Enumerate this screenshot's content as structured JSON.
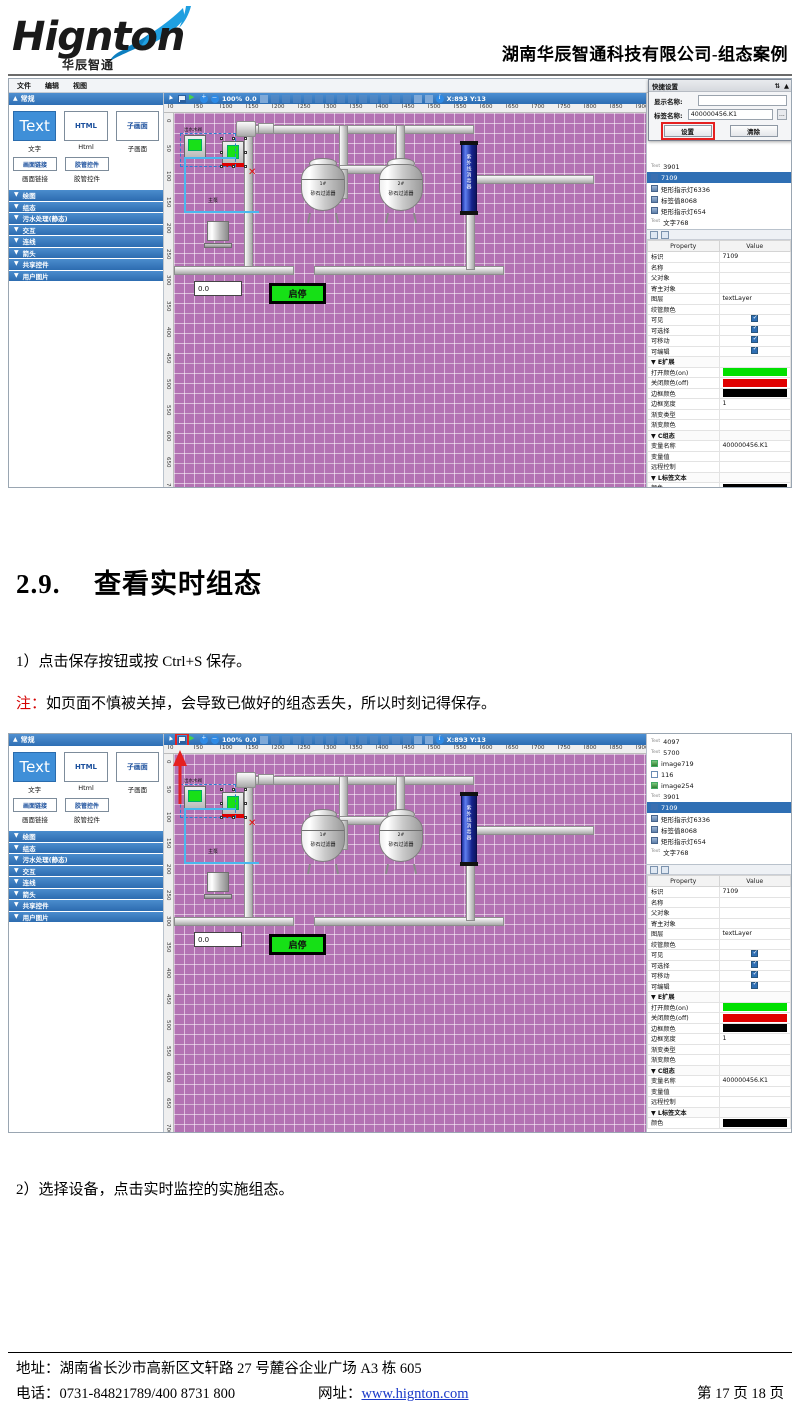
{
  "header": {
    "logo_text": "Hignton",
    "logo_sub": "华辰智通",
    "title": "湖南华辰智通科技有限公司-组态案例"
  },
  "document": {
    "section_number": "2.9.",
    "section_title": "查看实时组态",
    "step1": "1）点击保存按钮或按 Ctrl+S 保存。",
    "note_label": "注：",
    "note_text": "如页面不慎被关掉，会导致已做好的组态丢失，所以时刻记得保存。",
    "step2": "2）选择设备，点击实时监控的实施组态。"
  },
  "footer": {
    "address": "地址：湖南省长沙市高新区文轩路 27 号麓谷企业广场 A3 栋 605",
    "phone": "电话：0731-84821789/400 8731 800",
    "web_label": "网址：",
    "web_url": "www.hignton.com",
    "page": "第 17 页 18 页"
  },
  "app": {
    "menubar": [
      "文件",
      "编辑",
      "视图"
    ],
    "toolbox": {
      "header": "常规",
      "items": [
        {
          "swatch": "Text",
          "label": "文字"
        },
        {
          "swatch": "HTML",
          "label": "Html"
        },
        {
          "swatch": "子画面",
          "label": "子画面"
        },
        {
          "swatch": "画面链接",
          "label": "画面链接"
        },
        {
          "swatch": "胶管控件",
          "label": "胶管控件"
        }
      ],
      "sections": [
        "绘图",
        "组态",
        "污水处理(静态)",
        "交互",
        "连线",
        "箭头",
        "共享控件",
        "用户图片"
      ]
    },
    "canvas_toolbar": {
      "zoom": "100%",
      "angle": "0.0",
      "coords": "X:893 Y:13"
    },
    "ruler_h": [
      "0",
      "50",
      "100",
      "150",
      "200",
      "250",
      "300",
      "350",
      "400",
      "450",
      "500",
      "550",
      "600",
      "650",
      "700",
      "750",
      "800",
      "850",
      "900"
    ],
    "ruler_v": [
      "0",
      "50",
      "100",
      "150",
      "200",
      "250",
      "300",
      "350",
      "400",
      "450",
      "500",
      "550",
      "600",
      "650",
      "700"
    ],
    "diagram": {
      "tank1_num": "1#",
      "tank1_name": "砂石过滤器",
      "tank2_num": "2#",
      "tank2_name": "砂石过滤器",
      "column_label": "紫外线消毒器",
      "pump_label": "主泵",
      "valve_label": "出水水阀",
      "button_label": "启停",
      "value_box": "0.0"
    },
    "quick_settings": {
      "title": "快捷设置",
      "display_name_label": "显示名称:",
      "display_name_value": "",
      "tag_name_label": "标签名称:",
      "tag_name_value": "400000456.K1",
      "browse_label": "...",
      "ok_label": "设置",
      "clear_label": "清除"
    },
    "tree_top": [
      {
        "tag": "Text",
        "label": "3901",
        "icon": "text-icon",
        "selected": false
      },
      {
        "tag": "",
        "label": "7109",
        "icon": "block-icon",
        "selected": true
      },
      {
        "tag": "",
        "label": "矩形指示灯6336",
        "icon": "monitor-icon",
        "selected": false
      },
      {
        "tag": "",
        "label": "标签值8068",
        "icon": "monitor-icon",
        "selected": false
      },
      {
        "tag": "",
        "label": "矩形指示灯654",
        "icon": "monitor-icon",
        "selected": false
      },
      {
        "tag": "Text",
        "label": "文字768",
        "icon": "text-icon",
        "selected": false
      }
    ],
    "tree_full": [
      {
        "tag": "Text",
        "label": "4097",
        "icon": "text-icon",
        "selected": false
      },
      {
        "tag": "Text",
        "label": "5700",
        "icon": "text-icon",
        "selected": false
      },
      {
        "tag": "",
        "label": "image719",
        "icon": "image-icon",
        "selected": false
      },
      {
        "tag": "",
        "label": "116",
        "icon": "group-icon",
        "selected": false
      },
      {
        "tag": "",
        "label": "image254",
        "icon": "image-icon",
        "selected": false
      },
      {
        "tag": "Text",
        "label": "3901",
        "icon": "text-icon",
        "selected": false
      },
      {
        "tag": "",
        "label": "7109",
        "icon": "block-icon",
        "selected": true
      },
      {
        "tag": "",
        "label": "矩形指示灯6336",
        "icon": "monitor-icon",
        "selected": false
      },
      {
        "tag": "",
        "label": "标签值8068",
        "icon": "monitor-icon",
        "selected": false
      },
      {
        "tag": "",
        "label": "矩形指示灯654",
        "icon": "monitor-icon",
        "selected": false
      },
      {
        "tag": "Text",
        "label": "文字768",
        "icon": "text-icon",
        "selected": false
      }
    ],
    "properties": {
      "col_property": "Property",
      "col_value": "Value",
      "rows": [
        {
          "kind": "row",
          "name": "标识",
          "value": "7109"
        },
        {
          "kind": "row",
          "name": "名称",
          "value": ""
        },
        {
          "kind": "row",
          "name": "父对象",
          "value": ""
        },
        {
          "kind": "row",
          "name": "寄主对象",
          "value": ""
        },
        {
          "kind": "row",
          "name": "图层",
          "value": "textLayer"
        },
        {
          "kind": "row",
          "name": "绞管颜色",
          "value": ""
        },
        {
          "kind": "check",
          "name": "可见",
          "value": "checked"
        },
        {
          "kind": "check",
          "name": "可选择",
          "value": "checked"
        },
        {
          "kind": "check",
          "name": "可移动",
          "value": "checked"
        },
        {
          "kind": "check",
          "name": "可编辑",
          "value": "checked"
        },
        {
          "kind": "group",
          "name": "E扩展",
          "value": ""
        },
        {
          "kind": "color",
          "name": "打开颜色(on)",
          "value": "#00e000"
        },
        {
          "kind": "color",
          "name": "关闭颜色(off)",
          "value": "#e00000"
        },
        {
          "kind": "color",
          "name": "边框颜色",
          "value": "#000000"
        },
        {
          "kind": "row",
          "name": "边框宽度",
          "value": "1"
        },
        {
          "kind": "row",
          "name": "渐变类型",
          "value": ""
        },
        {
          "kind": "row",
          "name": "渐变颜色",
          "value": ""
        },
        {
          "kind": "group",
          "name": "C组态",
          "value": ""
        },
        {
          "kind": "row",
          "name": "变量名称",
          "value": "400000456.K1"
        },
        {
          "kind": "row",
          "name": "变量值",
          "value": ""
        },
        {
          "kind": "row",
          "name": "远程控制",
          "value": ""
        },
        {
          "kind": "group",
          "name": "L标签文本",
          "value": ""
        },
        {
          "kind": "color",
          "name": "颜色",
          "value": "#000000"
        }
      ]
    }
  },
  "colors": {
    "accent_blue": "#2f6fb4",
    "canvas_grid": "#b372b3",
    "green_on": "#00e000",
    "red_off": "#e00000",
    "annotation_red": "#e52020"
  }
}
